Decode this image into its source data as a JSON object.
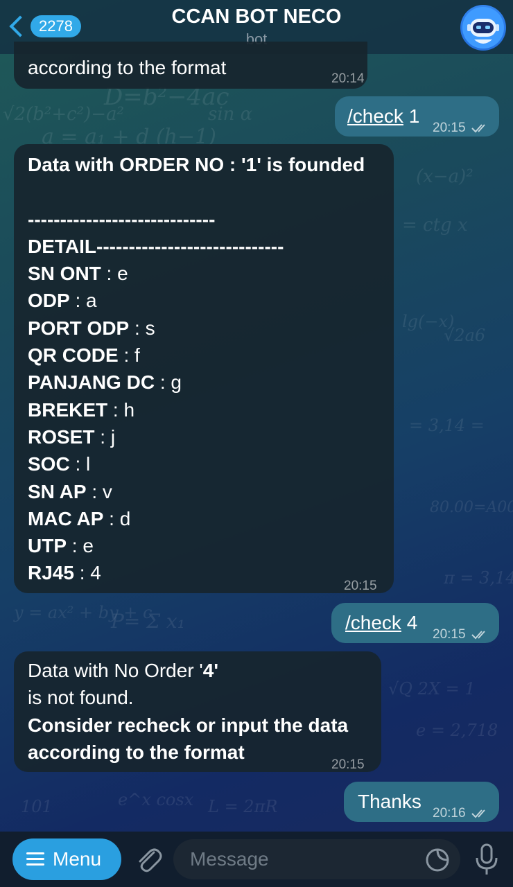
{
  "header": {
    "back_count": "2278",
    "title": "CCAN BOT NECO",
    "subtitle": "bot"
  },
  "messages": [
    {
      "dir": "in",
      "lines": [
        "according to the format"
      ],
      "time": "20:14"
    },
    {
      "dir": "out",
      "command": "/check",
      "arg": " 1",
      "time": "20:15"
    },
    {
      "dir": "in",
      "lines": [
        "Data with ORDER NO : '1' is founded",
        "",
        "-----------------------------",
        "DETAIL-----------------------------",
        "SN ONT : e",
        "ODP : a",
        "PORT ODP : s",
        "QR CODE : f",
        "PANJANG DC : g",
        "BREKET : h",
        "ROSET : j",
        "SOC : l",
        "SN AP : v",
        "MAC AP : d",
        "UTP : e",
        "RJ45 : 4"
      ],
      "fields": [
        {
          "key": "SN ONT",
          "value": "e"
        },
        {
          "key": "ODP",
          "value": "a"
        },
        {
          "key": "PORT ODP",
          "value": "s"
        },
        {
          "key": "QR CODE",
          "value": "f"
        },
        {
          "key": "PANJANG DC",
          "value": "g"
        },
        {
          "key": "BREKET",
          "value": "h"
        },
        {
          "key": "ROSET",
          "value": "j"
        },
        {
          "key": "SOC",
          "value": "l"
        },
        {
          "key": "SN AP",
          "value": "v"
        },
        {
          "key": "MAC AP",
          "value": "d"
        },
        {
          "key": "UTP",
          "value": "e"
        },
        {
          "key": "RJ45",
          "value": "4"
        }
      ],
      "heading": "Data with ORDER NO : '1' is founded",
      "sep1": "-----------------------------",
      "sep2": "DETAIL-----------------------------",
      "time": "20:15"
    },
    {
      "dir": "out",
      "command": "/check",
      "arg": " 4",
      "time": "20:15"
    },
    {
      "dir": "in",
      "l1a": "Data with No Order '",
      "l1b": "4",
      "l1c": "'",
      "l2": "is not found.",
      "l3": "Consider recheck or input the data",
      "l4": "according to the format",
      "time": "20:15"
    },
    {
      "dir": "out",
      "text": "Thanks",
      "time": "20:16"
    }
  ],
  "input": {
    "menu_label": "Menu",
    "placeholder": "Message"
  },
  "colors": {
    "accent": "#31a9e8",
    "outgoing_bubble": "#2e6e86",
    "incoming_bubble": "#17252e"
  },
  "icons": [
    "back-chevron-icon",
    "menu-lines-icon",
    "paperclip-icon",
    "sticker-icon",
    "microphone-icon",
    "double-check-icon"
  ]
}
